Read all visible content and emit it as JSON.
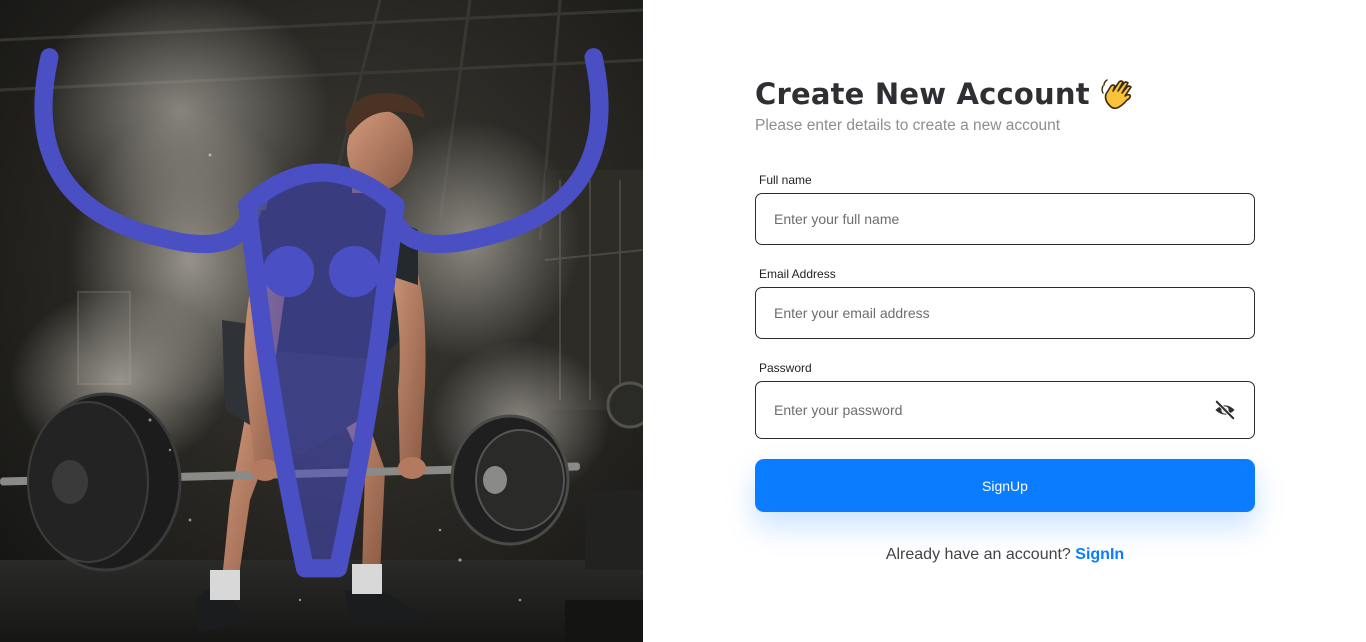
{
  "hero": {
    "logo_icon": "bull-skull-icon",
    "image_subject": "weightlifter-deadlift-photo"
  },
  "form": {
    "title": "Create New Account",
    "title_icon": "waving-hand-icon",
    "subtitle": "Please enter details to create a new account",
    "fields": {
      "full_name": {
        "label": "Full name",
        "placeholder": "Enter your full name",
        "value": ""
      },
      "email": {
        "label": "Email Address",
        "placeholder": "Enter your email address",
        "value": ""
      },
      "password": {
        "label": "Password",
        "placeholder": "Enter your password",
        "value": "",
        "toggle_icon": "eye-off-icon"
      }
    },
    "submit_label": "SignUp",
    "signin_prompt": "Already have an account?",
    "signin_link": "SignIn"
  },
  "colors": {
    "accent": "#0a7cff",
    "title": "#2f2f33",
    "subtitle": "#8e8e93",
    "logo": "#4a4fc4"
  }
}
